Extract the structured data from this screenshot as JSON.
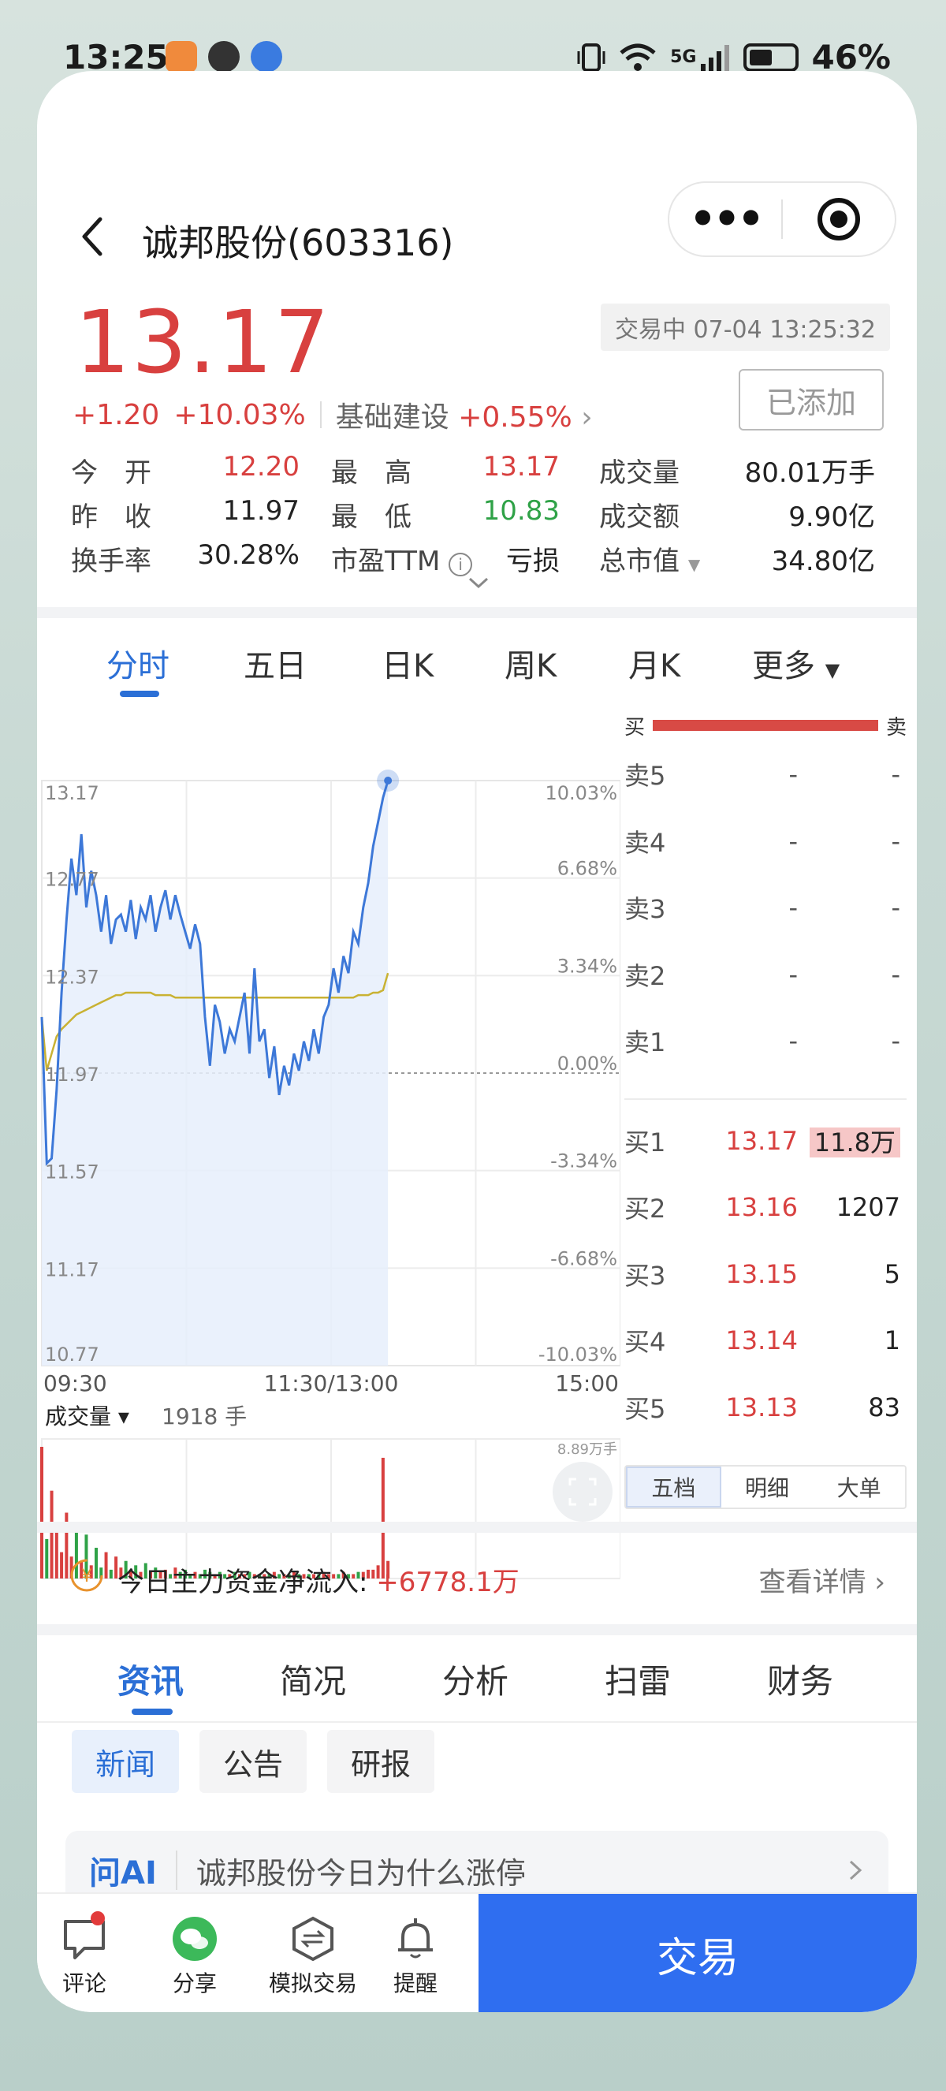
{
  "status_bar": {
    "time": "13:25",
    "battery": "46%",
    "network": "5G"
  },
  "header": {
    "title": "诚邦股份(603316)"
  },
  "quote": {
    "price": "13.17",
    "change": "+1.20",
    "change_pct": "+10.03%",
    "sector_name": "基础建设",
    "sector_pct": "+0.55%",
    "trade_status": "交易中 07-04 13:25:32",
    "add_label": "已添加"
  },
  "stats": [
    [
      {
        "label": "今　开",
        "value": "12.20",
        "color": "red"
      },
      {
        "label": "最　高",
        "value": "13.17",
        "color": "red"
      },
      {
        "label": "成交量",
        "value": "80.01万手",
        "color": "dark"
      }
    ],
    [
      {
        "label": "昨　收",
        "value": "11.97",
        "color": "dark"
      },
      {
        "label": "最　低",
        "value": "10.83",
        "color": "green"
      },
      {
        "label": "成交额",
        "value": "9.90亿",
        "color": "dark"
      }
    ],
    [
      {
        "label": "换手率",
        "value": "30.28%",
        "color": "dark"
      },
      {
        "label": "市盈TTM",
        "value": "亏损",
        "color": "dark"
      },
      {
        "label": "总市值",
        "value": "34.80亿",
        "color": "dark"
      }
    ]
  ],
  "chart_tabs": [
    "分时",
    "五日",
    "日K",
    "周K",
    "月K",
    "更多"
  ],
  "chart_data": {
    "type": "line",
    "y_left_ticks": [
      "13.17",
      "12.77",
      "12.37",
      "11.97",
      "11.57",
      "11.17",
      "10.77"
    ],
    "y_right_ticks": [
      "10.03%",
      "6.68%",
      "3.34%",
      "0.00%",
      "-3.34%",
      "-6.68%",
      "-10.03%"
    ],
    "x_ticks": [
      "09:30",
      "11:30/13:00",
      "15:00"
    ],
    "ylim": [
      10.77,
      13.17
    ],
    "prev_close": 11.97,
    "series": [
      {
        "values": [
          12.2,
          11.6,
          11.62,
          11.9,
          12.3,
          12.6,
          12.85,
          12.7,
          12.95,
          12.65,
          12.8,
          12.7,
          12.55,
          12.7,
          12.5,
          12.6,
          12.62,
          12.55,
          12.68,
          12.52,
          12.65,
          12.6,
          12.7,
          12.55,
          12.65,
          12.72,
          12.6,
          12.7,
          12.62,
          12.55,
          12.48,
          12.58,
          12.5,
          12.2,
          12.0,
          12.25,
          12.18,
          12.05,
          12.15,
          12.1,
          12.2,
          12.3,
          12.05,
          12.4,
          12.1,
          12.15,
          11.95,
          12.08,
          11.88,
          12.0,
          11.92,
          12.05,
          11.98,
          12.1,
          12.02,
          12.15,
          12.05,
          12.2,
          12.25,
          12.4,
          12.3,
          12.45,
          12.38,
          12.55,
          12.5,
          12.65,
          12.75,
          12.9,
          13.0,
          13.1,
          13.17
        ]
      },
      {
        "values": [
          12.2,
          11.98,
          12.05,
          12.12,
          12.15,
          12.17,
          12.19,
          12.21,
          12.22,
          12.23,
          12.24,
          12.25,
          12.26,
          12.27,
          12.28,
          12.29,
          12.29,
          12.3,
          12.3,
          12.3,
          12.3,
          12.3,
          12.3,
          12.29,
          12.29,
          12.29,
          12.29,
          12.28,
          12.28,
          12.28,
          12.28,
          12.28,
          12.28,
          12.28,
          12.28,
          12.28,
          12.28,
          12.28,
          12.28,
          12.28,
          12.28,
          12.28,
          12.28,
          12.28,
          12.28,
          12.28,
          12.28,
          12.28,
          12.28,
          12.28,
          12.28,
          12.28,
          12.28,
          12.28,
          12.28,
          12.28,
          12.28,
          12.28,
          12.28,
          12.28,
          12.28,
          12.28,
          12.28,
          12.28,
          12.29,
          12.29,
          12.29,
          12.3,
          12.3,
          12.31,
          12.38
        ]
      }
    ],
    "volume_label": "成交量",
    "volume_value": "1918 手",
    "volume_max": "8.89万手",
    "volume": [
      60,
      18,
      40,
      22,
      12,
      30,
      10,
      25,
      8,
      20,
      6,
      14,
      5,
      12,
      4,
      10,
      5,
      8,
      4,
      6,
      3,
      7,
      3,
      5,
      3,
      4,
      2,
      5,
      3,
      4,
      2,
      3,
      2,
      4,
      3,
      2,
      3,
      2,
      2,
      3,
      2,
      2,
      3,
      2,
      2,
      2,
      2,
      3,
      2,
      2,
      2,
      3,
      2,
      2,
      2,
      2,
      2,
      3,
      2,
      2,
      2,
      3,
      2,
      2,
      3,
      3,
      4,
      4,
      6,
      55,
      8
    ]
  },
  "order_book": {
    "buy_label": "买",
    "sell_label": "卖",
    "asks": [
      {
        "label": "卖5",
        "price": "-",
        "qty": "-"
      },
      {
        "label": "卖4",
        "price": "-",
        "qty": "-"
      },
      {
        "label": "卖3",
        "price": "-",
        "qty": "-"
      },
      {
        "label": "卖2",
        "price": "-",
        "qty": "-"
      },
      {
        "label": "卖1",
        "price": "-",
        "qty": "-"
      }
    ],
    "bids": [
      {
        "label": "买1",
        "price": "13.17",
        "qty": "11.8万"
      },
      {
        "label": "买2",
        "price": "13.16",
        "qty": "1207"
      },
      {
        "label": "买3",
        "price": "13.15",
        "qty": "5"
      },
      {
        "label": "买4",
        "price": "13.14",
        "qty": "1"
      },
      {
        "label": "买5",
        "price": "13.13",
        "qty": "83"
      }
    ],
    "tabs": [
      "五档",
      "明细",
      "大单"
    ]
  },
  "fund_flow": {
    "label": "今日主力资金净流入: ",
    "value": "+6778.1万",
    "link": "查看详情"
  },
  "info_tabs": [
    "资讯",
    "简况",
    "分析",
    "扫雷",
    "财务"
  ],
  "chips": [
    "新闻",
    "公告",
    "研报"
  ],
  "ask_ai": {
    "tag": "问AI",
    "question": "诚邦股份今日为什么涨停"
  },
  "bottom": {
    "comment": "评论",
    "share": "分享",
    "sim_trade": "模拟交易",
    "alert": "提醒",
    "trade": "交易"
  },
  "colors": {
    "up": "#d8403f",
    "down": "#2fa247",
    "accent": "#2b6fd6",
    "trade_button": "#2f6ef0"
  }
}
